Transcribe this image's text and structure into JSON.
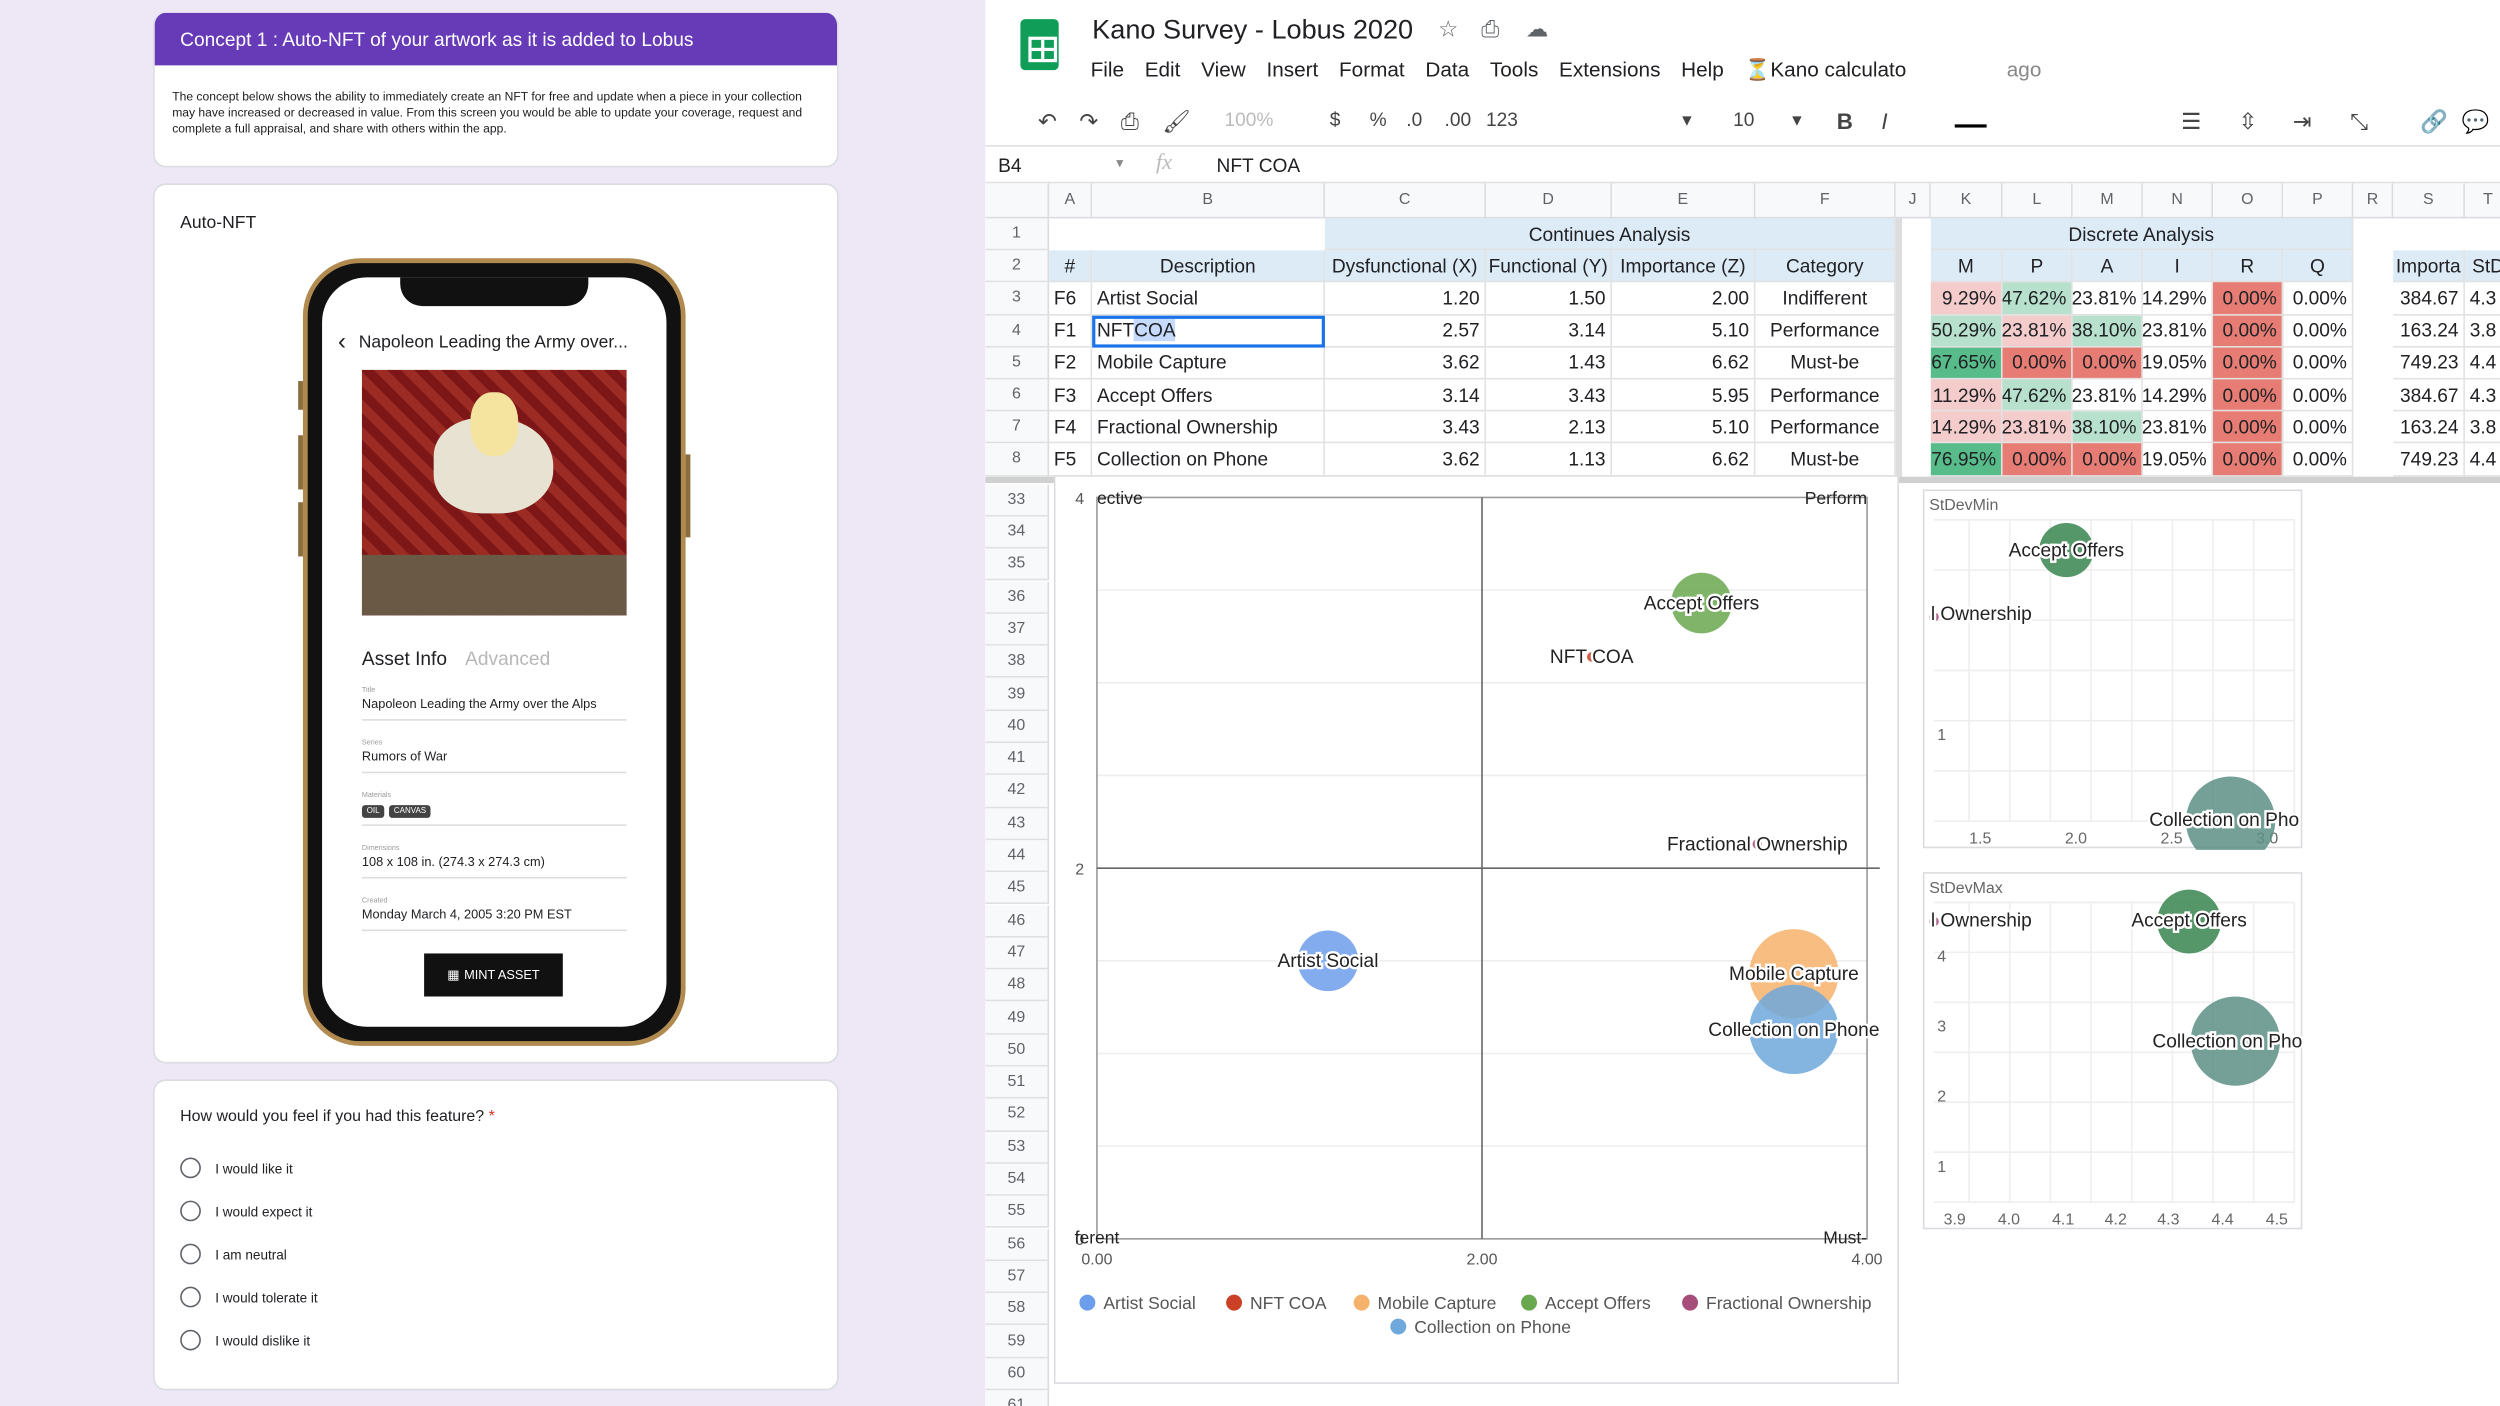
{
  "form": {
    "concept_title": "Concept 1 : Auto-NFT of your artwork as it is added to Lobus",
    "concept_desc": "The concept below shows the ability to immediately create an NFT for free  and update when a piece in your collection may have increased or decreased in value. From this screen you would be able to update your coverage, request and complete a full appraisal, and share with others within the app.",
    "section_label": "Auto-NFT",
    "phone": {
      "back_glyph": "‹",
      "header": "Napoleon Leading the Army over...",
      "tab_active": "Asset Info",
      "tab_inactive": "Advanced",
      "fields": [
        {
          "key": "Title",
          "value": "Napoleon Leading the Army over the Alps"
        },
        {
          "key": "Series",
          "value": "Rumors of War"
        },
        {
          "key": "Materials",
          "chips": [
            "OIL",
            "CANVAS"
          ]
        },
        {
          "key": "Dimensions",
          "value": "108 x 108 in. (274.3 x 274.3 cm)"
        },
        {
          "key": "Created",
          "value": "Monday March 4, 2005 3:20 PM EST"
        }
      ],
      "mint_label": "MINT ASSET"
    },
    "question": "How would you feel if you had this feature?",
    "required_mark": "*",
    "options": [
      "I would like it",
      "I would expect it",
      "I am neutral",
      "I would tolerate it",
      "I would dislike it"
    ]
  },
  "sheet": {
    "title": "Kano Survey - Lobus 2020",
    "menu": [
      "File",
      "Edit",
      "View",
      "Insert",
      "Format",
      "Data",
      "Tools",
      "Extensions",
      "Help"
    ],
    "addon_menu": "Kano calculato",
    "addon_suffix": "ago",
    "toolbar": {
      "zoom": "100%",
      "currency": "$",
      "percent": "%",
      "dec_less": ".0",
      "dec_more": ".00",
      "format": "123",
      "font_size": "10",
      "bold": "B",
      "italic": "I"
    },
    "name_box": "B4",
    "fx": "fx",
    "formula": "NFT COA",
    "col_headers": [
      "A",
      "B",
      "C",
      "D",
      "E",
      "F",
      "J",
      "K",
      "L",
      "M",
      "N",
      "O",
      "P",
      "R",
      "S",
      "T"
    ],
    "row_headers": [
      "1",
      "2",
      "3",
      "4",
      "5",
      "6",
      "7",
      "8",
      "33",
      "34",
      "35",
      "36",
      "37",
      "38",
      "39",
      "40",
      "41",
      "42",
      "43",
      "44",
      "45",
      "46",
      "47",
      "48",
      "49",
      "50",
      "51",
      "52",
      "53",
      "54",
      "55",
      "56",
      "57",
      "58",
      "59",
      "60",
      "61"
    ],
    "continues_header": "Continues Analysis",
    "discrete_header": "Discrete Analysis",
    "headers": {
      "hash": "#",
      "description": "Description",
      "dys": "Dysfunctional (X)",
      "func": "Functional (Y)",
      "imp": "Importance (Z)",
      "cat": "Category",
      "m": "M",
      "p": "P",
      "a": "A",
      "i": "I",
      "r": "R",
      "q": "Q",
      "importa": "Importa",
      "std": "StD"
    },
    "rows": [
      {
        "id": "F6",
        "desc": "Artist Social",
        "dys": "1.20",
        "func": "1.50",
        "imp": "2.00",
        "cat": "Indifferent",
        "m": "9.29%",
        "p": "47.62%",
        "a": "23.81%",
        "i": "14.29%",
        "r": "0.00%",
        "q": "0.00%",
        "importa": "384.67",
        "std": "4.3"
      },
      {
        "id": "F1",
        "desc": "NFT COA",
        "dys": "2.57",
        "func": "3.14",
        "imp": "5.10",
        "cat": "Performance",
        "m": "50.29%",
        "p": "23.81%",
        "a": "38.10%",
        "i": "23.81%",
        "r": "0.00%",
        "q": "0.00%",
        "importa": "163.24",
        "std": "3.8"
      },
      {
        "id": "F2",
        "desc": "Mobile Capture",
        "dys": "3.62",
        "func": "1.43",
        "imp": "6.62",
        "cat": "Must-be",
        "m": "67.65%",
        "p": "0.00%",
        "a": "0.00%",
        "i": "19.05%",
        "r": "0.00%",
        "q": "0.00%",
        "importa": "749.23",
        "std": "4.4"
      },
      {
        "id": "F3",
        "desc": "Accept Offers",
        "dys": "3.14",
        "func": "3.43",
        "imp": "5.95",
        "cat": "Performance",
        "m": "11.29%",
        "p": "47.62%",
        "a": "23.81%",
        "i": "14.29%",
        "r": "0.00%",
        "q": "0.00%",
        "importa": "384.67",
        "std": "4.3"
      },
      {
        "id": "F4",
        "desc": "Fractional Ownership",
        "dys": "3.43",
        "func": "2.13",
        "imp": "5.10",
        "cat": "Performance",
        "m": "14.29%",
        "p": "23.81%",
        "a": "38.10%",
        "i": "23.81%",
        "r": "0.00%",
        "q": "0.00%",
        "importa": "163.24",
        "std": "3.8"
      },
      {
        "id": "F5",
        "desc": "Collection on Phone",
        "dys": "3.62",
        "func": "1.13",
        "imp": "6.62",
        "cat": "Must-be",
        "m": "76.95%",
        "p": "0.00%",
        "a": "0.00%",
        "i": "19.05%",
        "r": "0.00%",
        "q": "0.00%",
        "importa": "749.23",
        "std": "4.4"
      }
    ],
    "cell_colors": {
      "m": [
        "#f4cccc",
        "#b7e1cd",
        "#57bb8a",
        "#f4cccc",
        "#f4cccc",
        "#57bb8a"
      ],
      "p": [
        "#b7e1cd",
        "#f4cccc",
        "#e67c73",
        "#b7e1cd",
        "#f4cccc",
        "#e67c73"
      ],
      "a": [
        "#ffffff",
        "#b7e1cd",
        "#e67c73",
        "#ffffff",
        "#b7e1cd",
        "#e67c73"
      ],
      "i": [
        "#ffffff",
        "#ffffff",
        "#ffffff",
        "#ffffff",
        "#ffffff",
        "#ffffff"
      ],
      "r": [
        "#e67c73",
        "#e67c73",
        "#e67c73",
        "#e67c73",
        "#e67c73",
        "#e67c73"
      ]
    }
  },
  "chart_data": [
    {
      "type": "scatter",
      "xlim": [
        0,
        4
      ],
      "ylim": [
        0,
        4
      ],
      "x_ticks": [
        "0.00",
        "2.00",
        "4.00"
      ],
      "y_ticks": [
        "0",
        "2",
        "4"
      ],
      "quadrant_labels": {
        "top_left": "ective",
        "top_right": "Perform",
        "bottom_left": "ferent",
        "bottom_right": "Must-"
      },
      "legend_placement": "bottom",
      "grid": true,
      "points": [
        {
          "name": "Artist Social",
          "x": 1.2,
          "y": 1.5,
          "color": "#6d9eeb"
        },
        {
          "name": "NFT COA",
          "x": 2.57,
          "y": 3.14,
          "color": "#cc4125"
        },
        {
          "name": "Mobile Capture",
          "x": 3.62,
          "y": 1.43,
          "color": "#f6b26b"
        },
        {
          "name": "Accept Offers",
          "x": 3.14,
          "y": 3.43,
          "color": "#6aa84f"
        },
        {
          "name": "Fractional Ownership",
          "x": 3.43,
          "y": 2.13,
          "color": "#a64d79"
        },
        {
          "name": "Collection on Phone",
          "x": 3.62,
          "y": 1.13,
          "color": "#6fa8dc"
        }
      ]
    },
    {
      "type": "scatter",
      "title": "StDevMin",
      "x_ticks": [
        "1.5",
        "2.0",
        "2.5",
        "3.0"
      ],
      "y_ticks": [
        "1"
      ],
      "point_labels": [
        "Accept Offers",
        "l Ownership",
        "Collection on Pho"
      ]
    },
    {
      "type": "scatter",
      "title": "StDevMax",
      "x_ticks": [
        "3.9",
        "4.0",
        "4.1",
        "4.2",
        "4.3",
        "4.4",
        "4.5"
      ],
      "y_ticks": [
        "4",
        "3",
        "2",
        "1"
      ],
      "point_labels": [
        "l Ownership",
        "Accept Offers",
        "Collection on Pho"
      ]
    }
  ]
}
